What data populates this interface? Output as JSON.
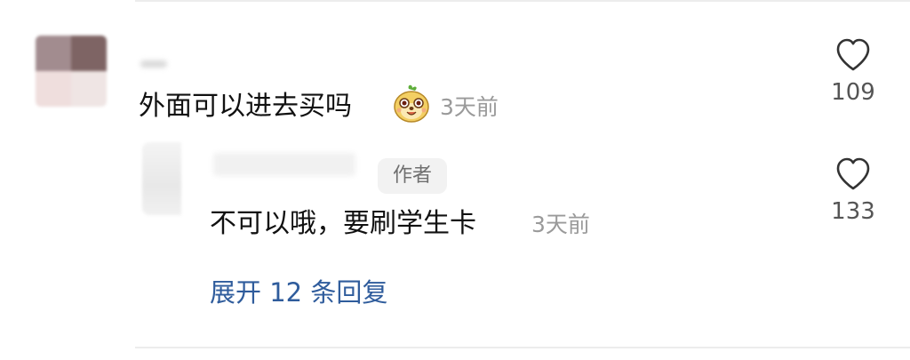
{
  "comment": {
    "text": "外面可以进去买吗",
    "emoji": "smiling-dog-emoji",
    "time": "3天前",
    "likes": "109"
  },
  "reply": {
    "badge": "作者",
    "text": "不可以哦，要刷学生卡",
    "time": "3天前",
    "likes": "133"
  },
  "expand_replies": "展开 12 条回复",
  "colors": {
    "link": "#2f5c9c",
    "muted": "#9a9a9a",
    "badge_bg": "#f2f2f2",
    "divider": "#ececec"
  }
}
